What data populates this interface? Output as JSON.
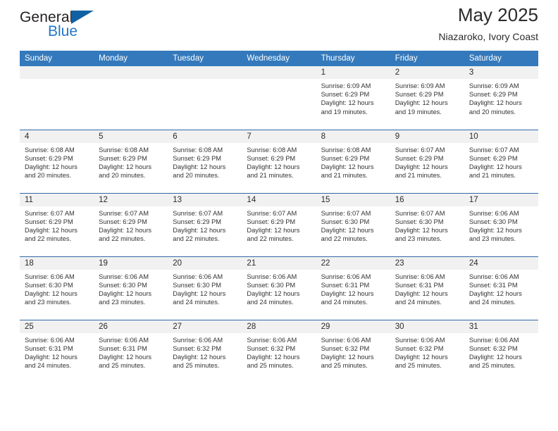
{
  "brand": {
    "name_top": "General",
    "name_bottom": "Blue",
    "triangle_color": "#1061a4",
    "blue_color": "#2277c8"
  },
  "header": {
    "title": "May 2025",
    "subtitle": "Niazaroko, Ivory Coast"
  },
  "theme": {
    "header_bg": "#3479bb",
    "row_divider": "#2f69a8",
    "daynum_bg": "#f1f1f1"
  },
  "labels": {
    "sunrise_prefix": "Sunrise:",
    "sunset_prefix": "Sunset:",
    "daylight_prefix": "Daylight:"
  },
  "weekdays": [
    "Sunday",
    "Monday",
    "Tuesday",
    "Wednesday",
    "Thursday",
    "Friday",
    "Saturday"
  ],
  "weeks": [
    [
      {
        "day": "",
        "sunrise": "",
        "sunset": "",
        "daylight_line1": "",
        "daylight_line2": ""
      },
      {
        "day": "",
        "sunrise": "",
        "sunset": "",
        "daylight_line1": "",
        "daylight_line2": ""
      },
      {
        "day": "",
        "sunrise": "",
        "sunset": "",
        "daylight_line1": "",
        "daylight_line2": ""
      },
      {
        "day": "",
        "sunrise": "",
        "sunset": "",
        "daylight_line1": "",
        "daylight_line2": ""
      },
      {
        "day": "1",
        "sunrise": "Sunrise: 6:09 AM",
        "sunset": "Sunset: 6:29 PM",
        "daylight_line1": "Daylight: 12 hours",
        "daylight_line2": "and 19 minutes."
      },
      {
        "day": "2",
        "sunrise": "Sunrise: 6:09 AM",
        "sunset": "Sunset: 6:29 PM",
        "daylight_line1": "Daylight: 12 hours",
        "daylight_line2": "and 19 minutes."
      },
      {
        "day": "3",
        "sunrise": "Sunrise: 6:09 AM",
        "sunset": "Sunset: 6:29 PM",
        "daylight_line1": "Daylight: 12 hours",
        "daylight_line2": "and 20 minutes."
      }
    ],
    [
      {
        "day": "4",
        "sunrise": "Sunrise: 6:08 AM",
        "sunset": "Sunset: 6:29 PM",
        "daylight_line1": "Daylight: 12 hours",
        "daylight_line2": "and 20 minutes."
      },
      {
        "day": "5",
        "sunrise": "Sunrise: 6:08 AM",
        "sunset": "Sunset: 6:29 PM",
        "daylight_line1": "Daylight: 12 hours",
        "daylight_line2": "and 20 minutes."
      },
      {
        "day": "6",
        "sunrise": "Sunrise: 6:08 AM",
        "sunset": "Sunset: 6:29 PM",
        "daylight_line1": "Daylight: 12 hours",
        "daylight_line2": "and 20 minutes."
      },
      {
        "day": "7",
        "sunrise": "Sunrise: 6:08 AM",
        "sunset": "Sunset: 6:29 PM",
        "daylight_line1": "Daylight: 12 hours",
        "daylight_line2": "and 21 minutes."
      },
      {
        "day": "8",
        "sunrise": "Sunrise: 6:08 AM",
        "sunset": "Sunset: 6:29 PM",
        "daylight_line1": "Daylight: 12 hours",
        "daylight_line2": "and 21 minutes."
      },
      {
        "day": "9",
        "sunrise": "Sunrise: 6:07 AM",
        "sunset": "Sunset: 6:29 PM",
        "daylight_line1": "Daylight: 12 hours",
        "daylight_line2": "and 21 minutes."
      },
      {
        "day": "10",
        "sunrise": "Sunrise: 6:07 AM",
        "sunset": "Sunset: 6:29 PM",
        "daylight_line1": "Daylight: 12 hours",
        "daylight_line2": "and 21 minutes."
      }
    ],
    [
      {
        "day": "11",
        "sunrise": "Sunrise: 6:07 AM",
        "sunset": "Sunset: 6:29 PM",
        "daylight_line1": "Daylight: 12 hours",
        "daylight_line2": "and 22 minutes."
      },
      {
        "day": "12",
        "sunrise": "Sunrise: 6:07 AM",
        "sunset": "Sunset: 6:29 PM",
        "daylight_line1": "Daylight: 12 hours",
        "daylight_line2": "and 22 minutes."
      },
      {
        "day": "13",
        "sunrise": "Sunrise: 6:07 AM",
        "sunset": "Sunset: 6:29 PM",
        "daylight_line1": "Daylight: 12 hours",
        "daylight_line2": "and 22 minutes."
      },
      {
        "day": "14",
        "sunrise": "Sunrise: 6:07 AM",
        "sunset": "Sunset: 6:29 PM",
        "daylight_line1": "Daylight: 12 hours",
        "daylight_line2": "and 22 minutes."
      },
      {
        "day": "15",
        "sunrise": "Sunrise: 6:07 AM",
        "sunset": "Sunset: 6:30 PM",
        "daylight_line1": "Daylight: 12 hours",
        "daylight_line2": "and 22 minutes."
      },
      {
        "day": "16",
        "sunrise": "Sunrise: 6:07 AM",
        "sunset": "Sunset: 6:30 PM",
        "daylight_line1": "Daylight: 12 hours",
        "daylight_line2": "and 23 minutes."
      },
      {
        "day": "17",
        "sunrise": "Sunrise: 6:06 AM",
        "sunset": "Sunset: 6:30 PM",
        "daylight_line1": "Daylight: 12 hours",
        "daylight_line2": "and 23 minutes."
      }
    ],
    [
      {
        "day": "18",
        "sunrise": "Sunrise: 6:06 AM",
        "sunset": "Sunset: 6:30 PM",
        "daylight_line1": "Daylight: 12 hours",
        "daylight_line2": "and 23 minutes."
      },
      {
        "day": "19",
        "sunrise": "Sunrise: 6:06 AM",
        "sunset": "Sunset: 6:30 PM",
        "daylight_line1": "Daylight: 12 hours",
        "daylight_line2": "and 23 minutes."
      },
      {
        "day": "20",
        "sunrise": "Sunrise: 6:06 AM",
        "sunset": "Sunset: 6:30 PM",
        "daylight_line1": "Daylight: 12 hours",
        "daylight_line2": "and 24 minutes."
      },
      {
        "day": "21",
        "sunrise": "Sunrise: 6:06 AM",
        "sunset": "Sunset: 6:30 PM",
        "daylight_line1": "Daylight: 12 hours",
        "daylight_line2": "and 24 minutes."
      },
      {
        "day": "22",
        "sunrise": "Sunrise: 6:06 AM",
        "sunset": "Sunset: 6:31 PM",
        "daylight_line1": "Daylight: 12 hours",
        "daylight_line2": "and 24 minutes."
      },
      {
        "day": "23",
        "sunrise": "Sunrise: 6:06 AM",
        "sunset": "Sunset: 6:31 PM",
        "daylight_line1": "Daylight: 12 hours",
        "daylight_line2": "and 24 minutes."
      },
      {
        "day": "24",
        "sunrise": "Sunrise: 6:06 AM",
        "sunset": "Sunset: 6:31 PM",
        "daylight_line1": "Daylight: 12 hours",
        "daylight_line2": "and 24 minutes."
      }
    ],
    [
      {
        "day": "25",
        "sunrise": "Sunrise: 6:06 AM",
        "sunset": "Sunset: 6:31 PM",
        "daylight_line1": "Daylight: 12 hours",
        "daylight_line2": "and 24 minutes."
      },
      {
        "day": "26",
        "sunrise": "Sunrise: 6:06 AM",
        "sunset": "Sunset: 6:31 PM",
        "daylight_line1": "Daylight: 12 hours",
        "daylight_line2": "and 25 minutes."
      },
      {
        "day": "27",
        "sunrise": "Sunrise: 6:06 AM",
        "sunset": "Sunset: 6:32 PM",
        "daylight_line1": "Daylight: 12 hours",
        "daylight_line2": "and 25 minutes."
      },
      {
        "day": "28",
        "sunrise": "Sunrise: 6:06 AM",
        "sunset": "Sunset: 6:32 PM",
        "daylight_line1": "Daylight: 12 hours",
        "daylight_line2": "and 25 minutes."
      },
      {
        "day": "29",
        "sunrise": "Sunrise: 6:06 AM",
        "sunset": "Sunset: 6:32 PM",
        "daylight_line1": "Daylight: 12 hours",
        "daylight_line2": "and 25 minutes."
      },
      {
        "day": "30",
        "sunrise": "Sunrise: 6:06 AM",
        "sunset": "Sunset: 6:32 PM",
        "daylight_line1": "Daylight: 12 hours",
        "daylight_line2": "and 25 minutes."
      },
      {
        "day": "31",
        "sunrise": "Sunrise: 6:06 AM",
        "sunset": "Sunset: 6:32 PM",
        "daylight_line1": "Daylight: 12 hours",
        "daylight_line2": "and 25 minutes."
      }
    ]
  ]
}
